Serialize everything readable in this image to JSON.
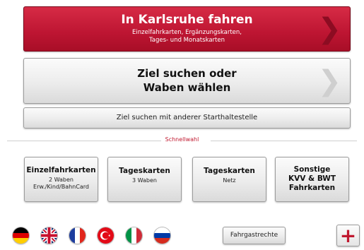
{
  "primary": {
    "title": "In Karlsruhe fahren",
    "subtitle_line1": "Einzelfahrkarten, Ergänzungskarten,",
    "subtitle_line2": "Tages- und Monatskarten"
  },
  "destination": {
    "line1": "Ziel suchen oder",
    "line2": "Waben wählen"
  },
  "other_start": {
    "label": "Ziel suchen mit anderer Starthaltestelle"
  },
  "quick_select": {
    "heading": "Schnellwahl",
    "items": [
      {
        "title": "Einzelfahrkarten",
        "sub1": "2 Waben",
        "sub2": "Erw./Kind/BahnCard"
      },
      {
        "title": "Tageskarten",
        "sub1": "3 Waben"
      },
      {
        "title": "Tageskarten",
        "sub1": "Netz"
      },
      {
        "title_line1": "Sonstige",
        "title_line2": "KVV & BWT",
        "title_line3": "Fahrkarten"
      }
    ]
  },
  "footer": {
    "languages": [
      "german-flag",
      "uk-flag",
      "french-flag",
      "turkish-flag",
      "italian-flag",
      "russian-flag"
    ],
    "passenger_rights": "Fahrgastrechte",
    "plus_label": "+"
  },
  "colors": {
    "accent_red": "#bd1532",
    "text": "#1a1a1a",
    "divider": "#d0d0d0"
  }
}
